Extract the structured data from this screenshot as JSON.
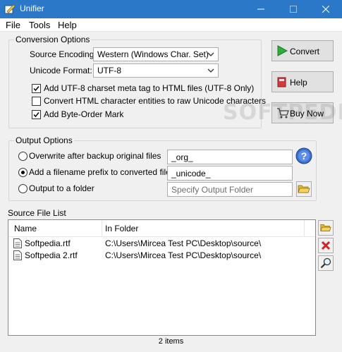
{
  "window": {
    "title": "Unifier",
    "accent": "#2b78c9"
  },
  "menu": [
    "File",
    "Tools",
    "Help"
  ],
  "conversion": {
    "group_title": "Conversion Options",
    "source_encoding_label": "Source Encoding:",
    "source_encoding_value": "Western (Windows Char. Set)",
    "unicode_format_label": "Unicode Format:",
    "unicode_format_value": "UTF-8",
    "options": [
      {
        "label": "Add UTF-8 charset meta tag to HTML files (UTF-8 Only)",
        "checked": true
      },
      {
        "label": "Convert HTML character entities to raw Unicode characters",
        "checked": false
      },
      {
        "label": "Add Byte-Order Mark",
        "checked": true
      }
    ]
  },
  "actions": {
    "convert": "Convert",
    "help": "Help",
    "buy": "Buy Now"
  },
  "output": {
    "group_title": "Output Options",
    "overwrite_label": "Overwrite after backup original files",
    "overwrite_value": "_org_",
    "prefix_label": "Add a filename prefix to converted files",
    "prefix_value": "_unicode_",
    "folder_label": "Output to a folder",
    "folder_placeholder": "Specify Output Folder",
    "selected": "prefix"
  },
  "source_list": {
    "label": "Source File List",
    "columns": [
      "Name",
      "In Folder"
    ],
    "rows": [
      {
        "name": "Softpedia.rtf",
        "folder": "C:\\Users\\Mircea Test PC\\Desktop\\source\\"
      },
      {
        "name": "Softpedia 2.rtf",
        "folder": "C:\\Users\\Mircea Test PC\\Desktop\\source\\"
      }
    ]
  },
  "status": "2 items",
  "watermark": "SOFTPEDIA"
}
